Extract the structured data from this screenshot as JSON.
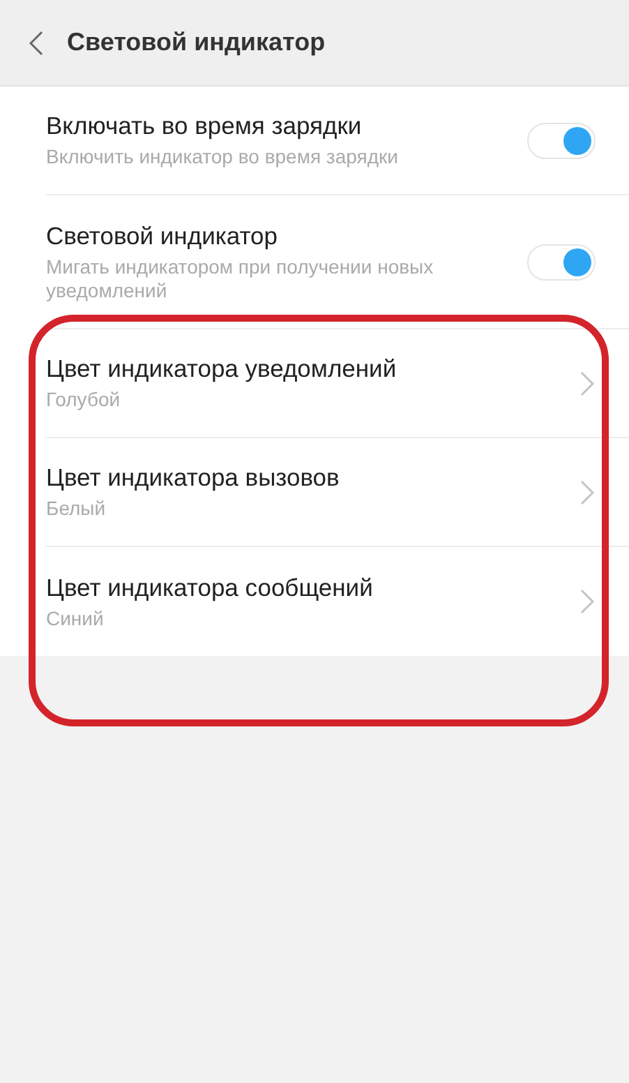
{
  "header": {
    "title": "Световой индикатор"
  },
  "settings": [
    {
      "kind": "toggle",
      "title": "Включать во время зарядки",
      "subtitle": "Включить индикатор во время зарядки",
      "on": true
    },
    {
      "kind": "toggle",
      "title": "Световой индикатор",
      "subtitle": "Мигать индикатором при получении новых уведомлений",
      "on": true
    },
    {
      "kind": "link",
      "title": "Цвет индикатора уведомлений",
      "subtitle": "Голубой"
    },
    {
      "kind": "link",
      "title": "Цвет индикатора вызовов",
      "subtitle": "Белый"
    },
    {
      "kind": "link",
      "title": "Цвет индикатора сообщений",
      "subtitle": "Синий"
    }
  ]
}
